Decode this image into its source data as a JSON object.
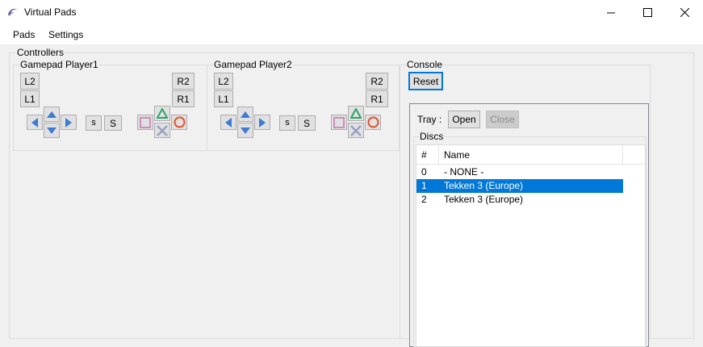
{
  "window": {
    "title": "Virtual Pads"
  },
  "menu": {
    "items": [
      "Pads",
      "Settings"
    ]
  },
  "controllers": {
    "title": "Controllers",
    "players": [
      {
        "title": "Gamepad Player1",
        "l2": "L2",
        "l1": "L1",
        "r2": "R2",
        "r1": "R1",
        "select": "s",
        "start": "S"
      },
      {
        "title": "Gamepad Player2",
        "l2": "L2",
        "l1": "L1",
        "r2": "R2",
        "r1": "R1",
        "select": "s",
        "start": "S"
      }
    ]
  },
  "console": {
    "title": "Console",
    "reset_label": "Reset",
    "tray_label": "Tray :",
    "open_label": "Open",
    "close_label": "Close",
    "discs": {
      "title": "Discs",
      "columns": [
        "#",
        "Name"
      ],
      "rows": [
        {
          "num": "0",
          "name": "- NONE -"
        },
        {
          "num": "1",
          "name": "Tekken 3 (Europe)"
        },
        {
          "num": "2",
          "name": "Tekken 3 (Europe)"
        }
      ],
      "selected_index": 1
    }
  },
  "colors": {
    "accent": "#0078d7",
    "triangle": "#2ca56a",
    "circle": "#e2542f",
    "square": "#c98fbf",
    "cross": "#9aa0c4"
  }
}
